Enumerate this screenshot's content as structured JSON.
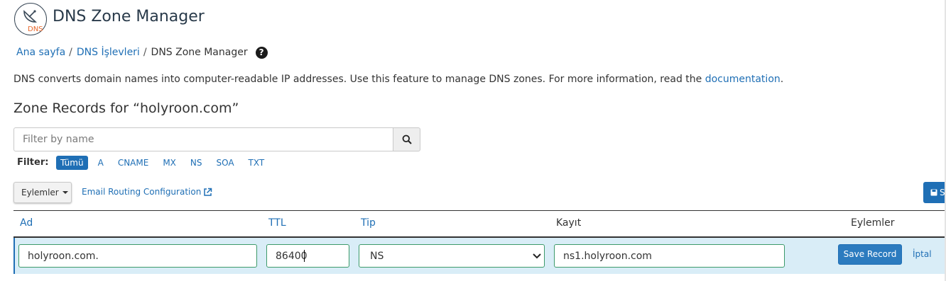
{
  "header": {
    "logo_text": "DNS",
    "title": "DNS Zone Manager"
  },
  "breadcrumb": {
    "items": [
      "Ana sayfa",
      "DNS İşlevleri"
    ],
    "current": "DNS Zone Manager",
    "separator": "/",
    "help_glyph": "?"
  },
  "description": {
    "text": "DNS converts domain names into computer-readable IP addresses. Use this feature to manage DNS zones. For more information, read the ",
    "link": "documentation",
    "suffix": "."
  },
  "zone_title": "Zone Records for “holyroon.com”",
  "search": {
    "placeholder": "Filter by name",
    "icon": "search-icon"
  },
  "filter": {
    "label": "Filter:",
    "options": [
      "Tümü",
      "A",
      "CNAME",
      "MX",
      "NS",
      "SOA",
      "TXT"
    ],
    "active": "Tümü"
  },
  "actions": {
    "dropdown_label": "Eylemler",
    "email_routing": "Email Routing Configuration",
    "save_all_label": "S"
  },
  "table": {
    "columns": [
      "Ad",
      "TTL",
      "Tip",
      "Kayıt",
      "Eylemler"
    ]
  },
  "edit_row": {
    "name": "holyroon.com.",
    "ttl": "86400",
    "type": "NS",
    "record": "ns1.holyroon.com",
    "save_label": "Save Record",
    "cancel_label": "İptal"
  },
  "colors": {
    "link": "#1f6fb5",
    "row_highlight": "#d9edf7",
    "field_border": "#3c9a6a",
    "logo_accent": "#e8672b"
  }
}
